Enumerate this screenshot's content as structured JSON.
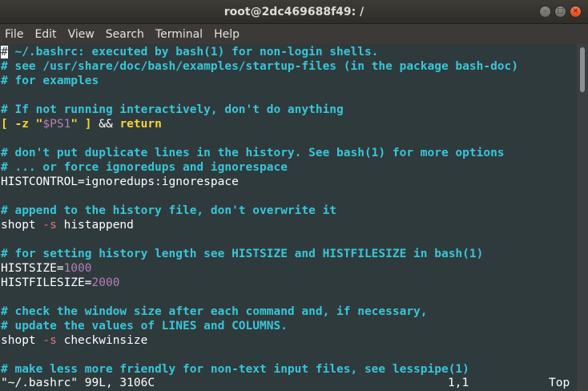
{
  "window": {
    "title": "root@2dc469688f49: /",
    "controls": {
      "minimize": "–",
      "maximize": "□",
      "close": "×"
    }
  },
  "menubar": {
    "items": [
      "File",
      "Edit",
      "View",
      "Search",
      "Terminal",
      "Help"
    ]
  },
  "editor": {
    "lines": [
      {
        "segments": [
          {
            "text": "#",
            "cls": "cursor"
          },
          {
            "text": " ~/.bashrc: executed by bash(1) for non-login shells.",
            "cls": "cm"
          }
        ]
      },
      {
        "segments": [
          {
            "text": "# see /usr/share/doc/bash/examples/startup-files (in the package bash-doc)",
            "cls": "cm"
          }
        ]
      },
      {
        "segments": [
          {
            "text": "# for examples",
            "cls": "cm"
          }
        ]
      },
      {
        "segments": []
      },
      {
        "segments": [
          {
            "text": "# If not running interactively, don't do anything",
            "cls": "cm"
          }
        ]
      },
      {
        "segments": [
          {
            "text": "[ -z ",
            "cls": "yl"
          },
          {
            "text": "\"",
            "cls": "yl"
          },
          {
            "text": "$PS1",
            "cls": "nm"
          },
          {
            "text": "\"",
            "cls": "yl"
          },
          {
            "text": " ] ",
            "cls": "yl"
          },
          {
            "text": "&& ",
            "cls": ""
          },
          {
            "text": "return",
            "cls": "yl"
          }
        ]
      },
      {
        "segments": []
      },
      {
        "segments": [
          {
            "text": "# don't put duplicate lines in the history. See bash(1) for more options",
            "cls": "cm"
          }
        ]
      },
      {
        "segments": [
          {
            "text": "# ... or force ignoredups and ignorespace",
            "cls": "cm"
          }
        ]
      },
      {
        "segments": [
          {
            "text": "HISTCONTROL=ignoredups:ignorespace",
            "cls": ""
          }
        ]
      },
      {
        "segments": []
      },
      {
        "segments": [
          {
            "text": "# append to the history file, don't overwrite it",
            "cls": "cm"
          }
        ]
      },
      {
        "segments": [
          {
            "text": "shopt ",
            "cls": ""
          },
          {
            "text": "-s",
            "cls": "pk"
          },
          {
            "text": " histappend",
            "cls": ""
          }
        ]
      },
      {
        "segments": []
      },
      {
        "segments": [
          {
            "text": "# for setting history length see HISTSIZE and HISTFILESIZE in bash(1)",
            "cls": "cm"
          }
        ]
      },
      {
        "segments": [
          {
            "text": "HISTSIZE=",
            "cls": ""
          },
          {
            "text": "1000",
            "cls": "nm"
          }
        ]
      },
      {
        "segments": [
          {
            "text": "HISTFILESIZE=",
            "cls": ""
          },
          {
            "text": "2000",
            "cls": "nm"
          }
        ]
      },
      {
        "segments": []
      },
      {
        "segments": [
          {
            "text": "# check the window size after each command and, if necessary,",
            "cls": "cm"
          }
        ]
      },
      {
        "segments": [
          {
            "text": "# update the values of LINES and COLUMNS.",
            "cls": "cm"
          }
        ]
      },
      {
        "segments": [
          {
            "text": "shopt ",
            "cls": ""
          },
          {
            "text": "-s",
            "cls": "pk"
          },
          {
            "text": " checkwinsize",
            "cls": ""
          }
        ]
      },
      {
        "segments": []
      },
      {
        "segments": [
          {
            "text": "# make less more friendly for non-text input files, see lesspipe(1)",
            "cls": "cm"
          }
        ]
      }
    ]
  },
  "statusline": {
    "file_info": "\"~/.bashrc\" 99L, 3106C",
    "position": "1,1",
    "scroll": "Top"
  },
  "colors": {
    "background": "#2f3a3d",
    "comment": "#38c6d8",
    "keyword": "#f5d531",
    "option": "#e27878",
    "number": "#b47fb8",
    "text": "#ffffff"
  }
}
